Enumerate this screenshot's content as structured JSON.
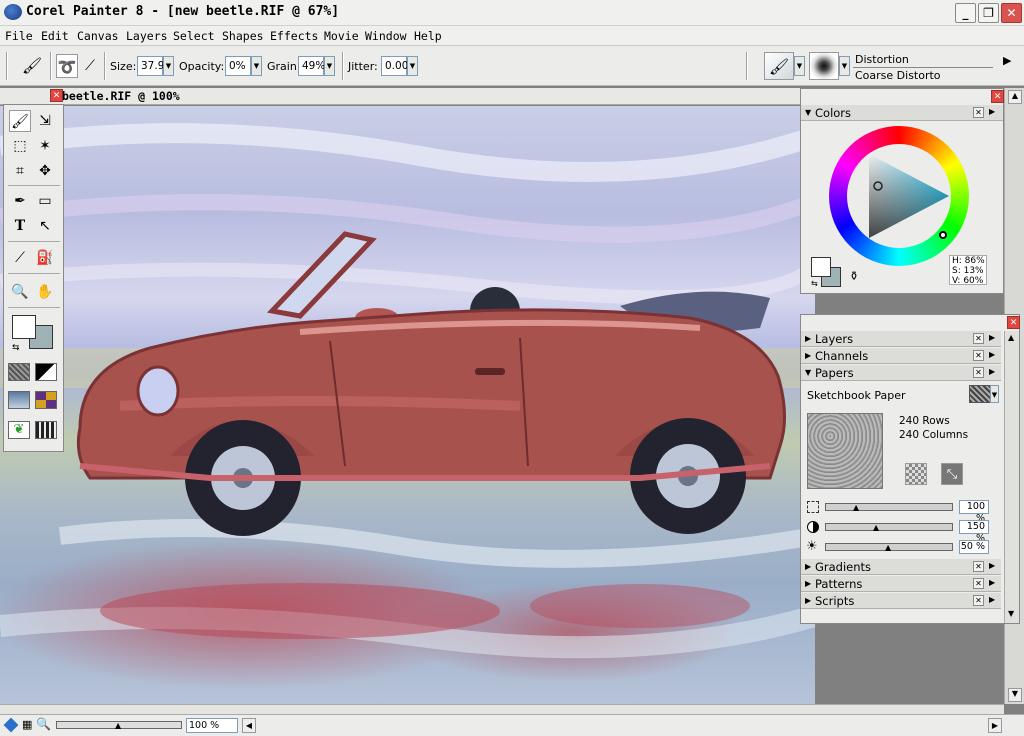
{
  "window": {
    "title": "Corel Painter 8 - [new beetle.RIF @ 67%]"
  },
  "menu": [
    "File",
    "Edit",
    "Canvas",
    "Layers",
    "Select",
    "Shapes",
    "Effects",
    "Movie",
    "Window",
    "Help"
  ],
  "property_bar": {
    "size_label": "Size:",
    "size_value": "37.9",
    "opacity_label": "Opacity:",
    "opacity_value": "0%",
    "grain_label": "Grain:",
    "grain_value": "49%",
    "jitter_label": "Jitter:",
    "jitter_value": "0.00",
    "brush_category": "Distortion",
    "brush_variant": "Coarse Distorto"
  },
  "document": {
    "title": "beetle.RIF @ 100%"
  },
  "toolbox": {
    "icons": [
      "brush-icon",
      "move-icon",
      "rect-select-icon",
      "magic-wand-icon",
      "crop-icon",
      "layer-adjuster-icon",
      "pen-icon",
      "rectangle-shape-icon",
      "text-icon",
      "shape-selection-icon",
      "dropper-icon",
      "paint-bucket-icon",
      "magnifier-icon",
      "grabber-icon"
    ],
    "primary_color": "#ffffff",
    "secondary_color": "#9fb3b6"
  },
  "colors_panel": {
    "title": "Colors",
    "h": "H: 86%",
    "s": "S: 13%",
    "v": "V: 60%"
  },
  "palettes": {
    "layers": "Layers",
    "channels": "Channels",
    "papers": "Papers",
    "paper_name": "Sketchbook Paper",
    "rows": "240 Rows",
    "columns": "240 Columns",
    "slider1": "100 %",
    "slider2": "150 %",
    "slider3": "50 %",
    "gradients": "Gradients",
    "patterns": "Patterns",
    "scripts": "Scripts"
  },
  "statusbar": {
    "zoom": "100 %",
    "zoom_fraction": 0.5
  }
}
